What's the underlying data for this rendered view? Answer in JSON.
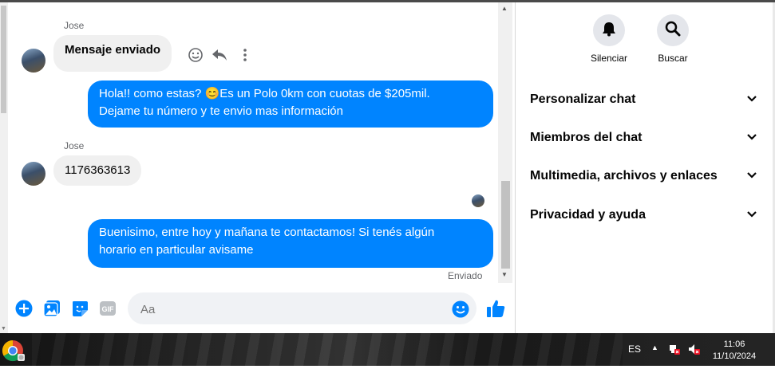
{
  "messages": [
    {
      "sender": "Jose",
      "text": "Mensaje enviado"
    },
    {
      "text_line1": "Hola!! como estas? 😊Es un Polo 0km con cuotas de $205mil.",
      "text_line2": "Dejame tu número y te envio mas información"
    },
    {
      "sender": "Jose",
      "text": "1176363613"
    },
    {
      "text_line1": "Buenisimo, entre hoy y mañana te contactamos! Si tenés algún",
      "text_line2": "horario en particular avisame"
    }
  ],
  "status": "Enviado",
  "composer": {
    "placeholder": "Aa"
  },
  "sidebar": {
    "actions": [
      {
        "label": "Silenciar",
        "icon": "bell-icon"
      },
      {
        "label": "Buscar",
        "icon": "search-icon"
      }
    ],
    "sections": [
      {
        "label": "Personalizar chat"
      },
      {
        "label": "Miembros del chat"
      },
      {
        "label": "Multimedia, archivos y enlaces"
      },
      {
        "label": "Privacidad y ayuda"
      }
    ]
  },
  "taskbar": {
    "language": "ES",
    "time": "11:06",
    "date": "11/10/2024"
  },
  "colors": {
    "accent": "#0084ff",
    "incoming_bubble": "#f0f0f0",
    "sidebar_button": "#e4e6eb"
  }
}
